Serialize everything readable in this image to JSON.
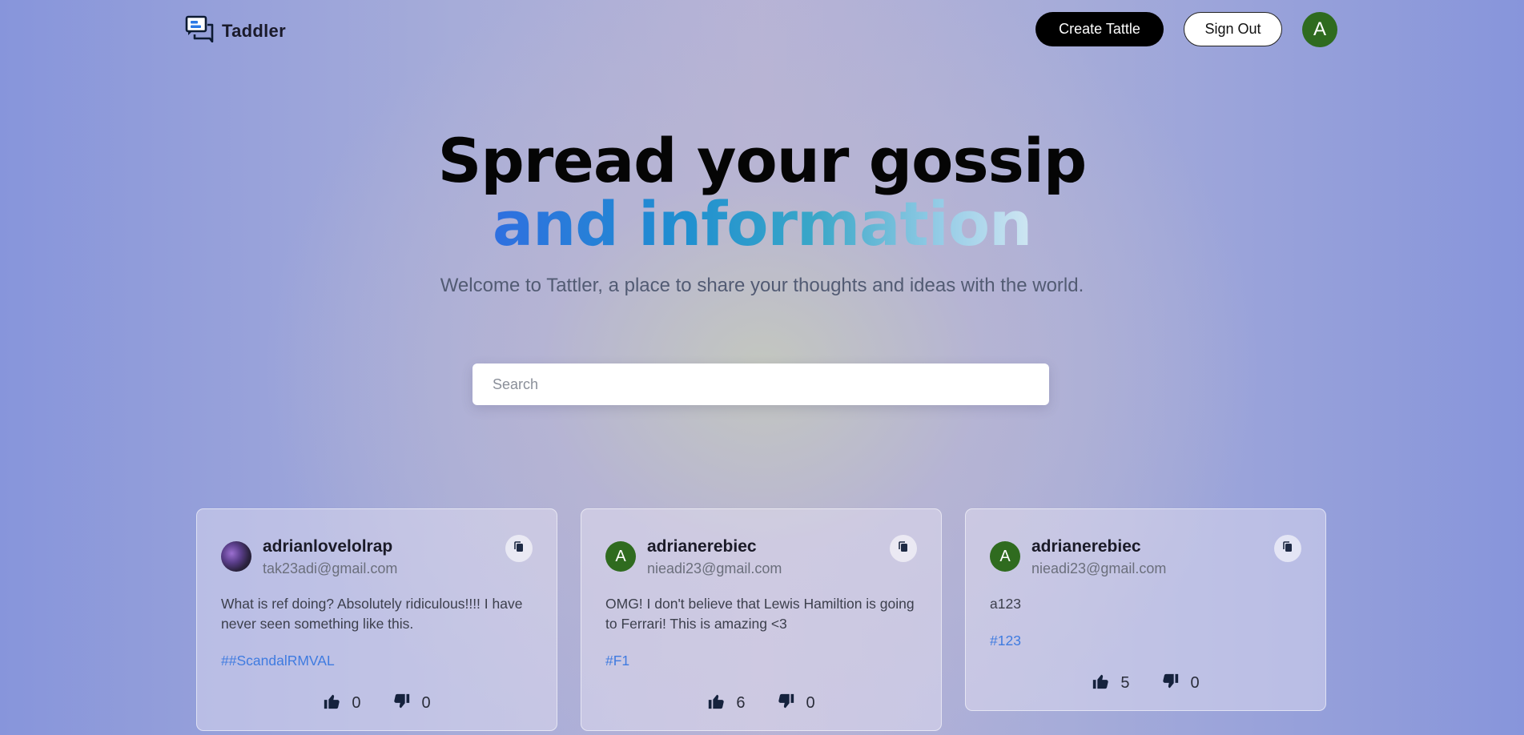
{
  "header": {
    "brand": "Taddler",
    "create_label": "Create Tattle",
    "signout_label": "Sign Out",
    "avatar_letter": "A"
  },
  "hero": {
    "title_line1": "Spread your gossip",
    "title_line2": "and information",
    "subtitle": "Welcome to Tattler, a place to share your thoughts and ideas with the world."
  },
  "search": {
    "placeholder": "Search",
    "value": ""
  },
  "colors": {
    "accent_link": "#3f7be0",
    "avatar_green": "#2f6b1f",
    "button_black": "#000000"
  },
  "cards": [
    {
      "username": "adrianlovelolrap",
      "email": "tak23adi@gmail.com",
      "avatar": "profile-photo",
      "content": "What is ref doing? Absolutely ridiculous!!!! I have never seen something like this.",
      "tag": "##ScandalRMVAL",
      "likes": "0",
      "dislikes": "0"
    },
    {
      "username": "adrianerebiec",
      "email": "nieadi23@gmail.com",
      "avatar": "A",
      "content": "OMG! I don't believe that Lewis Hamiltion is going to Ferrari! This is amazing <3",
      "tag": "#F1",
      "likes": "6",
      "dislikes": "0"
    },
    {
      "username": "adrianerebiec",
      "email": "nieadi23@gmail.com",
      "avatar": "A",
      "content": "a123",
      "tag": "#123",
      "likes": "5",
      "dislikes": "0"
    }
  ]
}
